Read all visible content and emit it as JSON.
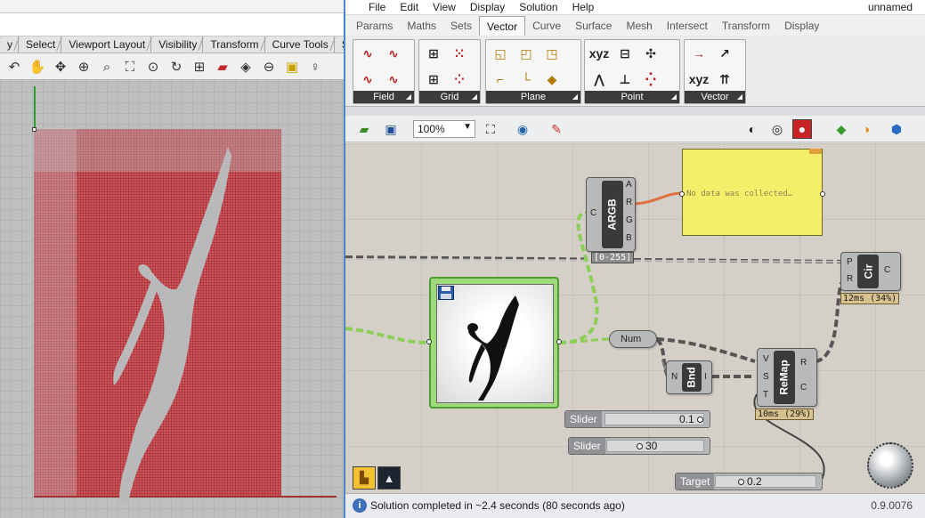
{
  "rhino": {
    "tabs": [
      "y",
      "Select",
      "Viewport Layout",
      "Visibility",
      "Transform",
      "Curve Tools",
      "Surfa"
    ],
    "toolbar_icons": [
      "undo-icon",
      "pan-hand-icon",
      "rotate-view-icon",
      "zoom-dynamic-icon",
      "zoom-window-icon",
      "zoom-extents-icon",
      "zoom-selected-icon",
      "rotate-icon",
      "four-viewports-icon",
      "car-render-icon",
      "material-icon",
      "circle-icon",
      "cplane-icon",
      "lightbulb-icon"
    ]
  },
  "gh": {
    "menu": [
      "File",
      "Edit",
      "View",
      "Display",
      "Solution",
      "Help"
    ],
    "document_name": "unnamed",
    "tabs": [
      "Params",
      "Maths",
      "Sets",
      "Vector",
      "Curve",
      "Surface",
      "Mesh",
      "Intersect",
      "Transform",
      "Display"
    ],
    "active_tab": "Vector",
    "ribbon_groups": [
      {
        "label": "Field",
        "icons": [
          "field-icon",
          "field-icon",
          "field-icon",
          "field-icon"
        ]
      },
      {
        "label": "Grid",
        "icons": [
          "grid-icon",
          "grid-icon",
          "grid-icon",
          "grid-icon"
        ]
      },
      {
        "label": "Plane",
        "icons": [
          "plane-icon",
          "plane-icon",
          "plane-icon",
          "plane-icon",
          "plane-icon",
          "plane-icon"
        ]
      },
      {
        "label": "Point",
        "icons": [
          "point-icon",
          "point-icon",
          "point-icon",
          "point-icon",
          "point-icon",
          "point-icon"
        ]
      },
      {
        "label": "Vector",
        "icons": [
          "vector-icon",
          "vector-icon",
          "vector-icon",
          "vector-icon"
        ]
      }
    ],
    "canvas_toolbar": {
      "zoom": "100%",
      "icons": [
        "open-file-icon",
        "save-icon",
        "zoom-extents-icon",
        "eye-icon",
        "sketch-icon",
        "preview-shaded-icon",
        "preview-wire-icon",
        "preview-off-icon",
        "preview-selected-icon",
        "preview-color-icon",
        "render-icon"
      ]
    },
    "components": {
      "argb": {
        "name": "ARGB",
        "inputs": [
          "C"
        ],
        "outputs": [
          "A",
          "R",
          "G",
          "B"
        ],
        "tag": "[0-255]"
      },
      "panel": {
        "text": "No data was collected…"
      },
      "circle": {
        "name": "Cir",
        "inputs": [
          "P",
          "R"
        ],
        "outputs": [
          "C"
        ],
        "timing": "12ms (34%)"
      },
      "number": {
        "name": "Num"
      },
      "bounds": {
        "name": "Bnd",
        "inputs": [
          "N"
        ],
        "outputs": [
          "I"
        ]
      },
      "remap": {
        "name": "ReMap",
        "inputs": [
          "V",
          "S",
          "T"
        ],
        "outputs": [
          "R",
          "C"
        ],
        "timing": "10ms (29%)"
      }
    },
    "sliders": [
      {
        "name": "Slider",
        "value": "0.1"
      },
      {
        "name": "Slider",
        "value": "30"
      },
      {
        "name": "Target",
        "value": "0.2"
      }
    ],
    "status": {
      "text": "Solution completed in ~2.4 seconds (80 seconds ago)",
      "version": "0.9.0076"
    }
  },
  "colors": {
    "wire_selected": "#8ccf55",
    "wire_active": "#e07040",
    "panel_bg": "#f5ee6b",
    "points": "#a8262d"
  }
}
